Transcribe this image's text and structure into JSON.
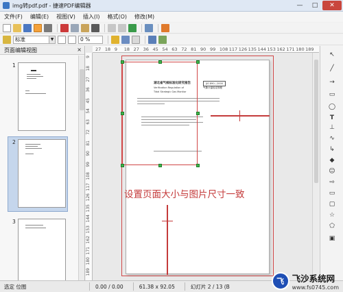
{
  "window": {
    "title": "img转pdf.pdf - 捷速PDF编辑器",
    "minimize": "—",
    "maximize": "□",
    "close": "✕"
  },
  "menu": {
    "items": [
      "文件(F)",
      "编辑(E)",
      "视图(V)",
      "插入(I)",
      "格式(O)",
      "修改(M)"
    ]
  },
  "toolbar2": {
    "style_value": "标准",
    "percent_value": "0 %"
  },
  "left_panel": {
    "title": "页面编辑视图",
    "close": "×",
    "pages": [
      {
        "number": "1"
      },
      {
        "number": "2"
      },
      {
        "number": "3"
      }
    ],
    "selected_page": "2"
  },
  "ruler": {
    "h_labels": [
      "27",
      "18",
      "9",
      "18",
      "27",
      "36",
      "45",
      "54",
      "63",
      "72",
      "81",
      "90",
      "99",
      "108",
      "117",
      "126",
      "135",
      "144",
      "153",
      "162",
      "171",
      "180",
      "189"
    ],
    "v_labels": [
      "9",
      "18",
      "27",
      "36",
      "45",
      "54",
      "63",
      "72",
      "81",
      "90",
      "99",
      "108",
      "117",
      "126",
      "135",
      "144",
      "153",
      "162",
      "171",
      "180",
      "189"
    ]
  },
  "document": {
    "title_line": "湖北省气候标准化研究报告",
    "subtitle_line": "Verification Regulation of",
    "en_line": "Tidal Strategic Gas Monitor",
    "code_box_1": "JJG 890—2000",
    "code_box_2": "气象计量检定规程"
  },
  "annotation": {
    "text": "设置页面大小与图片尺寸一致"
  },
  "status": {
    "selection": "选定 位图",
    "position": "0.00 / 0.00",
    "size": "61.38 x 92.05",
    "slide": "幻灯片 2 / 13 (B"
  },
  "watermark": {
    "name": "飞沙系统网",
    "url": "www.fs0745.com"
  },
  "colors": {
    "accent_red": "#c43a3a",
    "selection_blue": "#c5d6ec",
    "handle_green": "#3fb54b"
  }
}
